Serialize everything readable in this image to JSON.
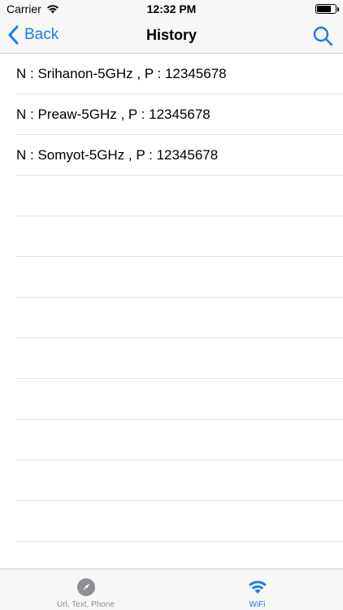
{
  "status_bar": {
    "carrier": "Carrier",
    "time": "12:32 PM",
    "battery_level": 0.75
  },
  "nav": {
    "back_label": "Back",
    "title": "History",
    "accent_color": "#1d7bef"
  },
  "history_items": [
    {
      "text": "N : Srihanon-5GHz , P : 12345678"
    },
    {
      "text": "N : Preaw-5GHz , P : 12345678"
    },
    {
      "text": "N : Somyot-5GHz , P : 12345678"
    },
    {
      "text": ""
    },
    {
      "text": ""
    },
    {
      "text": ""
    },
    {
      "text": ""
    },
    {
      "text": ""
    },
    {
      "text": ""
    },
    {
      "text": ""
    },
    {
      "text": ""
    },
    {
      "text": ""
    }
  ],
  "tabbar": {
    "tabs": [
      {
        "label": "Url, Text, Phone",
        "icon": "compass-icon",
        "active": false
      },
      {
        "label": "WiFi",
        "icon": "wifi-icon",
        "active": true
      }
    ]
  }
}
